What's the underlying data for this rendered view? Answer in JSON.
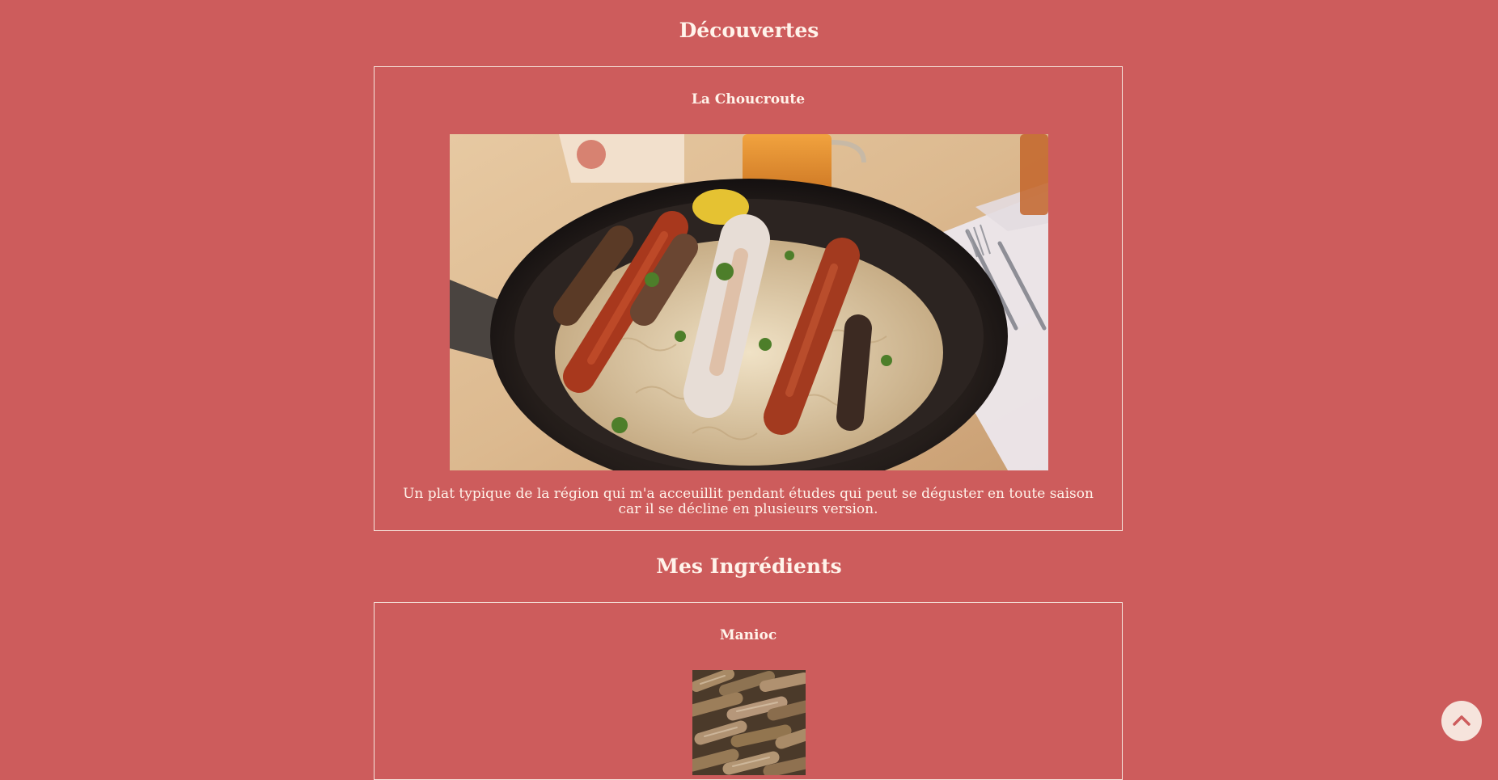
{
  "sections": {
    "discoveries": {
      "title": "Découvertes",
      "card": {
        "title": "La Choucroute",
        "image_alt": "La Choucroute",
        "description": "Un plat typique de la région qui m'a acceuillit pendant études qui peut se déguster en toute saison car il se décline en plusieurs version."
      }
    },
    "ingredients": {
      "title": "Mes Ingrédients",
      "card": {
        "title": "Manioc",
        "image_alt": "Manioc"
      }
    }
  },
  "scroll_top": {
    "icon": "chevron-up-icon",
    "aria_label": "Retour en haut"
  },
  "colors": {
    "background": "#cd5c5c",
    "text": "#fff3ea",
    "border": "#f6e6de",
    "button_bg": "#f6e4dc",
    "button_icon": "#cd5c5c"
  }
}
